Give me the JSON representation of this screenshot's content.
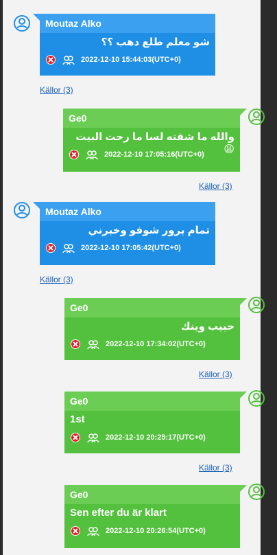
{
  "messages": [
    {
      "direction": "incoming",
      "sender": "Moutaz Alko",
      "text": "شو معلم طلع دهب ؟؟",
      "timestamp": "2022-12-10 15:44:03(UTC+0)",
      "sources": "Källor (3)"
    },
    {
      "direction": "outgoing",
      "sender": "Ge0",
      "text": "والله ما شفته لسا ما رحت البيت 😩",
      "timestamp": "2022-12-10 17:05:16(UTC+0)",
      "sources": "Källor (3)"
    },
    {
      "direction": "incoming",
      "sender": "Moutaz Alko",
      "text": "تمام برور شوفو وخبرني",
      "timestamp": "2022-12-10 17:05:42(UTC+0)",
      "sources": "Källor (3)"
    },
    {
      "direction": "outgoing",
      "sender": "Ge0",
      "text": "حبيب وينك",
      "timestamp": "2022-12-10 17:34:02(UTC+0)",
      "sources": "Källor (3)"
    },
    {
      "direction": "outgoing",
      "sender": "Ge0",
      "text": "1st",
      "timestamp": "2022-12-10 20:25:17(UTC+0)",
      "sources": "Källor (3)"
    },
    {
      "direction": "outgoing",
      "sender": "Ge0",
      "text": "Sen efter du är klart",
      "timestamp": "2022-12-10 20:26:54(UTC+0)",
      "sources": ""
    }
  ],
  "colors": {
    "incoming": "#1f8fe6",
    "outgoing": "#53c13d",
    "link": "#1a5fb4"
  },
  "icons": [
    "user-avatar-icon",
    "delete-icon",
    "participants-icon"
  ]
}
